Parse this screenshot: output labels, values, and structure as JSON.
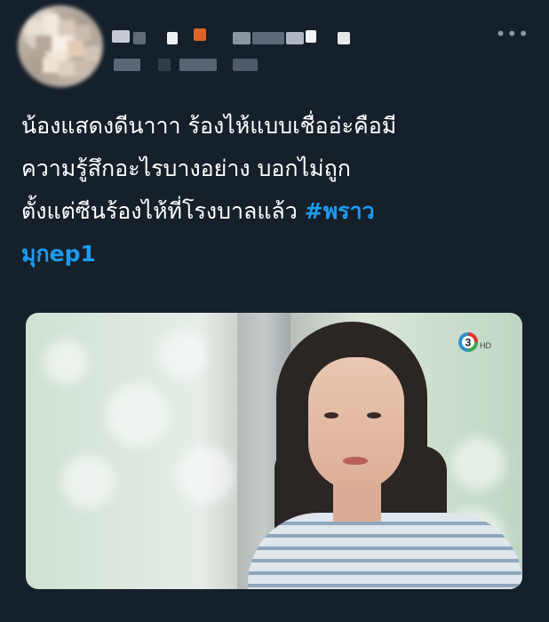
{
  "tweet": {
    "author": {
      "avatar_icon": "blurred-avatar",
      "name_redacted": true,
      "handle_redacted": true
    },
    "more_icon": "more-dots-icon",
    "more_glyph": "•••",
    "text_lines": [
      "น้องแสดงดีนาาา ร้องไห้แบบเชื่ออ่ะคือมี",
      "ความรู้สึกอะไรบางอย่าง บอกไม่ถูก",
      "ตั้งแต่ซีนร้องไห้ที่โรงบาลแล้ว "
    ],
    "hashtag_part1": "#พราว",
    "hashtag_part2": "มุกep1",
    "media": {
      "description_icon": "video-still-image",
      "channel_logo": "channel-3-hd-logo",
      "channel_label": "3",
      "channel_suffix": "HD"
    }
  },
  "colors": {
    "background": "#15202b",
    "text": "#ffffff",
    "hashtag": "#1d9bf0",
    "muted": "#8b98a5"
  }
}
